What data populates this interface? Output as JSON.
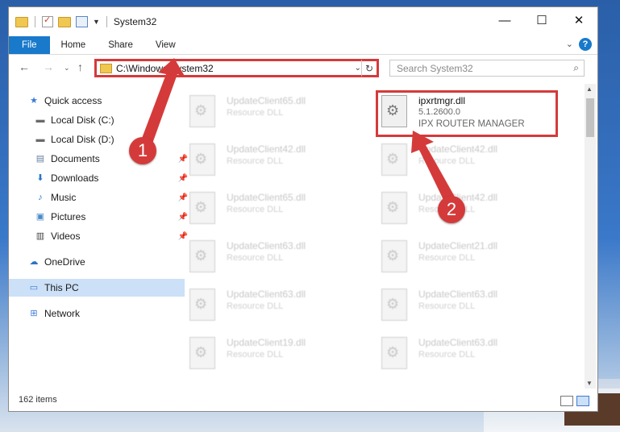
{
  "window": {
    "title": "System32",
    "controls": {
      "minimize": "—",
      "maximize": "☐",
      "close": "✕"
    }
  },
  "ribbon": {
    "tabs": [
      "File",
      "Home",
      "Share",
      "View"
    ]
  },
  "nav": {
    "address": "C:\\Windows\\System32",
    "search_placeholder": "Search System32"
  },
  "sidebar": {
    "items": [
      {
        "label": "Quick access",
        "icon": "star-icon"
      },
      {
        "label": "Local Disk (C:)",
        "icon": "drive-icon"
      },
      {
        "label": "Local Disk (D:)",
        "icon": "drive-icon"
      },
      {
        "label": "Documents",
        "icon": "documents-icon"
      },
      {
        "label": "Downloads",
        "icon": "download-icon"
      },
      {
        "label": "Music",
        "icon": "music-icon"
      },
      {
        "label": "Pictures",
        "icon": "pictures-icon"
      },
      {
        "label": "Videos",
        "icon": "videos-icon"
      },
      {
        "label": "OneDrive",
        "icon": "cloud-icon"
      },
      {
        "label": "This PC",
        "icon": "computer-icon"
      },
      {
        "label": "Network",
        "icon": "network-icon"
      }
    ]
  },
  "files": {
    "highlighted": {
      "name": "ipxrtmgr.dll",
      "version": "5.1.2600.0",
      "description": "IPX ROUTER MANAGER"
    },
    "left_column": [
      {
        "name": "UpdateClient65.dll",
        "desc": "Resource DLL"
      },
      {
        "name": "UpdateClient42.dll",
        "desc": "Resource DLL"
      },
      {
        "name": "UpdateClient65.dll",
        "desc": "Resource DLL"
      },
      {
        "name": "UpdateClient63.dll",
        "desc": "Resource DLL"
      },
      {
        "name": "UpdateClient63.dll",
        "desc": "Resource DLL"
      },
      {
        "name": "UpdateClient19.dll",
        "desc": "Resource DLL"
      }
    ],
    "right_column": [
      {
        "name": "UpdateClient42.dll",
        "desc": "Resource DLL"
      },
      {
        "name": "UpdateClient42.dll",
        "desc": "Resource DLL"
      },
      {
        "name": "UpdateClient21.dll",
        "desc": "Resource DLL"
      },
      {
        "name": "UpdateClient63.dll",
        "desc": "Resource DLL"
      },
      {
        "name": "UpdateClient63.dll",
        "desc": "Resource DLL"
      }
    ]
  },
  "status": {
    "item_count": "162 items"
  },
  "callouts": [
    "1",
    "2"
  ],
  "colors": {
    "accent": "#1979ca",
    "highlight": "#d53a3a",
    "selected": "#cce0f7"
  }
}
